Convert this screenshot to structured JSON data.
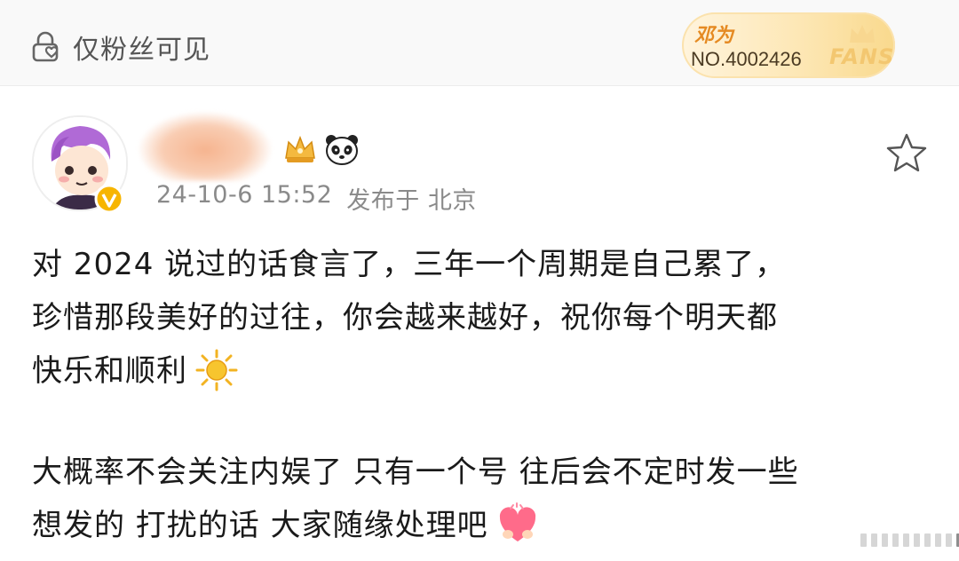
{
  "topbar": {
    "visibility_label": "仅粉丝可见",
    "fans_badge": {
      "name": "邓为",
      "number": "NO.4002426",
      "word": "FANS"
    }
  },
  "post": {
    "timestamp": "24-10-6 15:52",
    "location": "发布于 北京",
    "paragraphs": [
      {
        "lines": [
          "对 2024 说过的话食言了，三年一个周期是自己累了，",
          "珍惜那段美好的过往，你会越来越好，祝你每个明天都",
          "快乐和顺利"
        ]
      },
      {
        "lines": [
          "大概率不会关注内娱了 只有一个号 往后会不定时发一些",
          "想发的 打扰的话 大家随缘处理吧"
        ]
      }
    ]
  },
  "pager": {
    "count": 10,
    "active_index": 9
  },
  "colors": {
    "fans_name": "#e58a22",
    "muted_text": "#8a8a8a",
    "body_text": "#1a1a1a",
    "verified": "#f7b500"
  }
}
